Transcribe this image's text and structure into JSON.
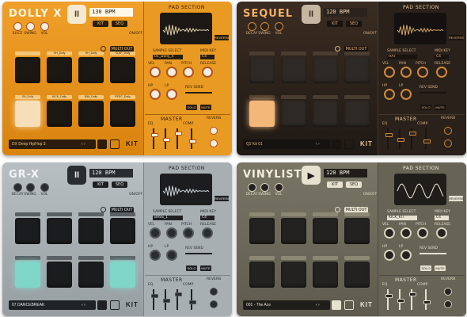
{
  "panels": [
    {
      "id": "dolly-x",
      "logo": "DOLLY X",
      "bpm": "130 BPM",
      "play_symbol": "II",
      "kit_label": "KIT",
      "seq_label": "SEQ",
      "knob_labels": [
        "SLICE",
        "SWING",
        "VOL"
      ],
      "on_off": "ON/OFF",
      "pad_section": "PAD SECTION",
      "reverse": "REVERSE",
      "multi_out": "MULTI OUT",
      "sample_select": "SAMPLE SELECT",
      "sample_name": "01_Dolly_X",
      "midi_key": "MIDI KEY",
      "midi_val": "C4",
      "param_labels": [
        "VEL",
        "PAN",
        "PITCH",
        "RELEASE",
        "HP",
        "LP",
        "REV SEND"
      ],
      "solo": "SOLO",
      "mute": "MUTE",
      "master": "MASTER",
      "eq": "EQ",
      "comp": "COMP",
      "reverb": "REVERB",
      "preset": "DX Deep HipHop 3",
      "pad_names": [
        "",
        "HH_Dolly",
        "HH_Dolly",
        "CLAP_Dolly",
        "SN_Dolly",
        "KICK_Dolly",
        "RIM_Dolly",
        "PERC_Dolly"
      ],
      "brand": "KIT",
      "colors": {
        "bg": "#e4901a",
        "dark": "#1c1814",
        "accent": "#f6c56b"
      }
    },
    {
      "id": "sequel",
      "logo": "SEQUEL",
      "bpm": "120 BPM",
      "play_symbol": "II",
      "kit_label": "KIT",
      "seq_label": "SEQ",
      "knob_labels": [
        "DECAY",
        "SWING",
        "VOL"
      ],
      "on_off": "ON/OFF",
      "pad_section": "PAD SECTION",
      "reverse": "REVERSE",
      "multi_out": "MULTI OUT",
      "sample_select": "SAMPLE SELECT",
      "sample_name": "HAT",
      "midi_key": "MIDI KEY",
      "midi_val": "C4",
      "param_labels": [
        "VEL",
        "PAN",
        "PITCH",
        "RELEASE",
        "HP",
        "LP",
        "REV SEND"
      ],
      "solo": "SOLO",
      "mute": "MUTE",
      "master": "MASTER",
      "eq": "EQ",
      "comp": "COMP",
      "reverb": "REVERB",
      "preset": "Q2 Kit 01",
      "brand": "KIT",
      "colors": {
        "bg": "#2b221c",
        "dark": "#15110e",
        "accent": "#d08a3a"
      }
    },
    {
      "id": "gr-x",
      "logo": "GR-X",
      "bpm": "120 BPM",
      "play_symbol": "II",
      "kit_label": "KIT",
      "seq_label": "SEQ",
      "knob_labels": [
        "DECAY",
        "SWING",
        "VOL"
      ],
      "on_off": "ON/OFF",
      "pad_section": "PAD SECTION",
      "reverse": "REVERSE",
      "multi_out": "MULTI OUT",
      "sample_select": "SAMPLE SELECT",
      "sample_name": "BASS_1",
      "midi_key": "MIDI KEY",
      "midi_val": "C4",
      "param_labels": [
        "VEL",
        "PAN",
        "PITCH",
        "RELEASE",
        "HP",
        "LP",
        "REV SEND"
      ],
      "solo": "SOLO",
      "mute": "MUTE",
      "master": "MASTER",
      "eq": "EQ",
      "comp": "COMP",
      "reverb": "REVERB",
      "preset": "07 DANCEBREAK",
      "brand": "KIT",
      "colors": {
        "bg": "#a9b1b5",
        "dark": "#1e2022",
        "accent": "#7fd6c8"
      }
    },
    {
      "id": "vinylistik",
      "logo": "VINYLISTIK",
      "bpm": "120 BPM",
      "play_symbol": "▶",
      "kit_label": "KIT",
      "seq_label": "SEQ",
      "knob_labels": [
        "DECAY",
        "SWING",
        "VOL"
      ],
      "on_off": "ON/OFF",
      "pad_section": "PAD SECTION",
      "reverse": "REVERSE",
      "multi_out": "MULTI OUT",
      "sample_select": "SAMPLE SELECT",
      "sample_name": "KICK_KIT",
      "midi_key": "MIDI KEY",
      "midi_val": "C4",
      "param_labels": [
        "VEL",
        "PAN",
        "PITCH",
        "RELEASE",
        "HP",
        "LP",
        "REV SEND"
      ],
      "solo": "SOLO",
      "mute": "MUTE",
      "master": "MASTER",
      "eq": "EQ",
      "comp": "COMP",
      "reverb": "REVERB",
      "preset": "001 - The Ace",
      "brand": "KIT",
      "colors": {
        "bg": "#6d6a5c",
        "dark": "#1f1e1a",
        "accent": "#e7e2cf"
      }
    }
  ]
}
